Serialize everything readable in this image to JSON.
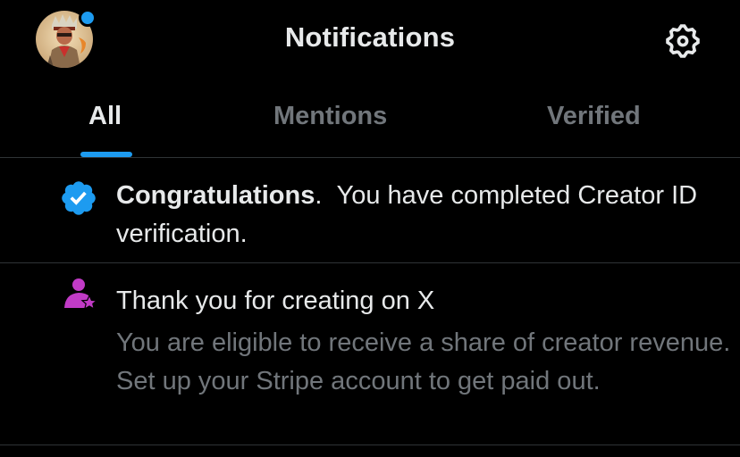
{
  "colors": {
    "accent": "#1d9bf0",
    "text_primary": "#e7e9ea",
    "text_secondary": "#71767b",
    "background": "#000000",
    "divider": "#2f3336",
    "creator_icon": "#c13bc6"
  },
  "header": {
    "title": "Notifications",
    "avatar_icon": "user-avatar",
    "settings_icon": "gear-icon",
    "has_unread_badge": true
  },
  "tabs": [
    {
      "label": "All",
      "selected": true
    },
    {
      "label": "Mentions",
      "selected": false
    },
    {
      "label": "Verified",
      "selected": false
    }
  ],
  "notifications": [
    {
      "icon": "verified-badge-icon",
      "title": "Congratulations",
      "punctuation": ".",
      "message": "You have completed Creator ID verification."
    },
    {
      "icon": "creator-star-icon",
      "title": "Thank you for creating on X",
      "body": "You are eligible to receive a share of creator revenue. Set up your Stripe account to get paid out."
    }
  ]
}
